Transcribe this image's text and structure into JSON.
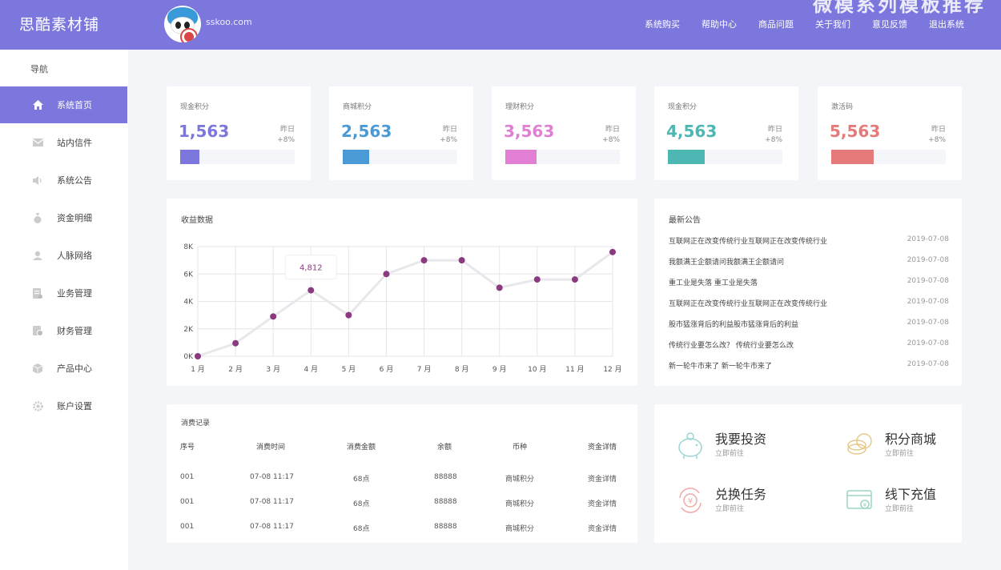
{
  "header": {
    "brand": "思酷素材铺",
    "domain": "sskoo.com",
    "watermark": "微模系列模板推荐",
    "nav": [
      "系统购买",
      "帮助中心",
      "商品问题",
      "关于我们",
      "意见反馈",
      "退出系统"
    ]
  },
  "sidebar": {
    "title": "导航",
    "items": [
      {
        "label": "系统首页",
        "icon": "home-icon",
        "active": true
      },
      {
        "label": "站内信件",
        "icon": "mail-icon"
      },
      {
        "label": "系统公告",
        "icon": "speaker-icon"
      },
      {
        "label": "资金明细",
        "icon": "money-bag-icon"
      },
      {
        "label": "人脉网络",
        "icon": "people-icon"
      },
      {
        "label": "业务管理",
        "icon": "document-icon"
      },
      {
        "label": "财务管理",
        "icon": "finance-icon"
      },
      {
        "label": "产品中心",
        "icon": "box-icon"
      },
      {
        "label": "账户设置",
        "icon": "gear-icon"
      }
    ]
  },
  "stats": [
    {
      "label": "现金积分",
      "value": "1,563",
      "prev_label": "昨日",
      "change": "+8%",
      "color": "#7c77dc",
      "progress": 0.17
    },
    {
      "label": "商城积分",
      "value": "2,563",
      "prev_label": "昨日",
      "change": "+8%",
      "color": "#4a9ad6",
      "progress": 0.23
    },
    {
      "label": "理财积分",
      "value": "3,563",
      "prev_label": "昨日",
      "change": "+8%",
      "color": "#e07fd3",
      "progress": 0.27
    },
    {
      "label": "现金积分",
      "value": "4,563",
      "prev_label": "昨日",
      "change": "+8%",
      "color": "#4fb7b3",
      "progress": 0.32
    },
    {
      "label": "激活码",
      "value": "5,563",
      "prev_label": "昨日",
      "change": "+8%",
      "color": "#e47a7a",
      "progress": 0.37
    }
  ],
  "income": {
    "title": "收益数据",
    "tooltip": "4,812"
  },
  "chart_data": {
    "type": "line",
    "categories": [
      "1 月",
      "2 月",
      "3 月",
      "4 月",
      "5 月",
      "6 月",
      "7 月",
      "8 月",
      "9 月",
      "10 月",
      "11 月",
      "12 月"
    ],
    "values": [
      0,
      950,
      2900,
      4812,
      3000,
      6000,
      7000,
      7000,
      5000,
      5600,
      5600,
      7600
    ],
    "yticks": [
      "0K",
      "2K",
      "4K",
      "6K",
      "8K"
    ],
    "ylim": [
      0,
      8000
    ],
    "grid": true,
    "line_color": "#e8e8ec",
    "point_color": "#8b3a7f"
  },
  "notices": {
    "title": "最新公告",
    "items": [
      {
        "text": "互联网正在改变传统行业互联网正在改变传统行业",
        "date": "2019-07-08"
      },
      {
        "text": "我额满王企额请问我额满王企额请问",
        "date": "2019-07-08"
      },
      {
        "text": "重工业是失落 重工业是失落",
        "date": "2019-07-08"
      },
      {
        "text": "互联网正在改变传统行业互联网正在改变传统行业",
        "date": "2019-07-08"
      },
      {
        "text": "股市猛涨背后的利益股市猛涨背后的利益",
        "date": "2019-07-08"
      },
      {
        "text": "传统行业要怎么改？ 传统行业要怎么改",
        "date": "2019-07-08"
      },
      {
        "text": "新一轮牛市来了 新一轮牛市来了",
        "date": "2019-07-08"
      }
    ]
  },
  "records": {
    "title": "消费记录",
    "headers": [
      "序号",
      "消费时间",
      "消费金额",
      "余额",
      "币种",
      "资金详情"
    ],
    "rows": [
      [
        "001",
        "07-08  11:17",
        "68点",
        "88888",
        "商城积分",
        "资金详情"
      ],
      [
        "001",
        "07-08  11:17",
        "68点",
        "88888",
        "商城积分",
        "资金详情"
      ],
      [
        "001",
        "07-08  11:17",
        "68点",
        "88888",
        "商城积分",
        "资金详情"
      ]
    ]
  },
  "quick_links": [
    {
      "title": "我要投资",
      "sub": "立即前往",
      "icon": "piggy-bank-icon"
    },
    {
      "title": "积分商城",
      "sub": "立即前往",
      "icon": "coins-icon"
    },
    {
      "title": "兑换任务",
      "sub": "立即前往",
      "icon": "yuan-exchange-icon"
    },
    {
      "title": "线下充值",
      "sub": "立即前往",
      "icon": "card-recharge-icon"
    }
  ]
}
